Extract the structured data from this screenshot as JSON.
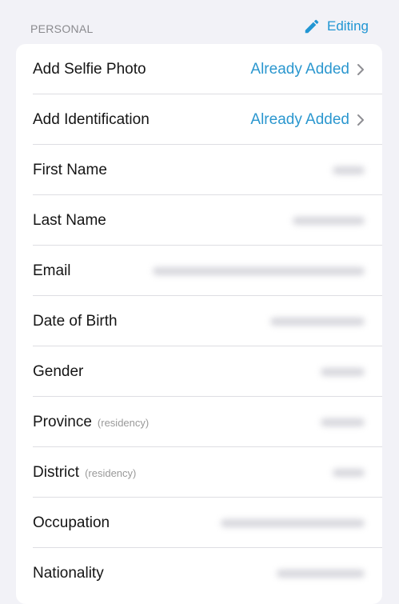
{
  "section": {
    "title": "PERSONAL",
    "edit_label": "Editing"
  },
  "colors": {
    "accent": "#2196d3",
    "background": "#f2f2f7",
    "card": "#ffffff"
  },
  "rows": [
    {
      "label": "Add Selfie Photo",
      "value": "Already Added"
    },
    {
      "label": "Add Identification",
      "value": "Already Added"
    },
    {
      "label": "First Name"
    },
    {
      "label": "Last Name"
    },
    {
      "label": "Email"
    },
    {
      "label": "Date of Birth"
    },
    {
      "label": "Gender"
    },
    {
      "label": "Province",
      "hint": "(residency)"
    },
    {
      "label": "District",
      "hint": "(residency)"
    },
    {
      "label": "Occupation"
    },
    {
      "label": "Nationality"
    }
  ],
  "icons": {
    "edit": "pencil-icon",
    "disclosure": "chevron-right-icon"
  }
}
